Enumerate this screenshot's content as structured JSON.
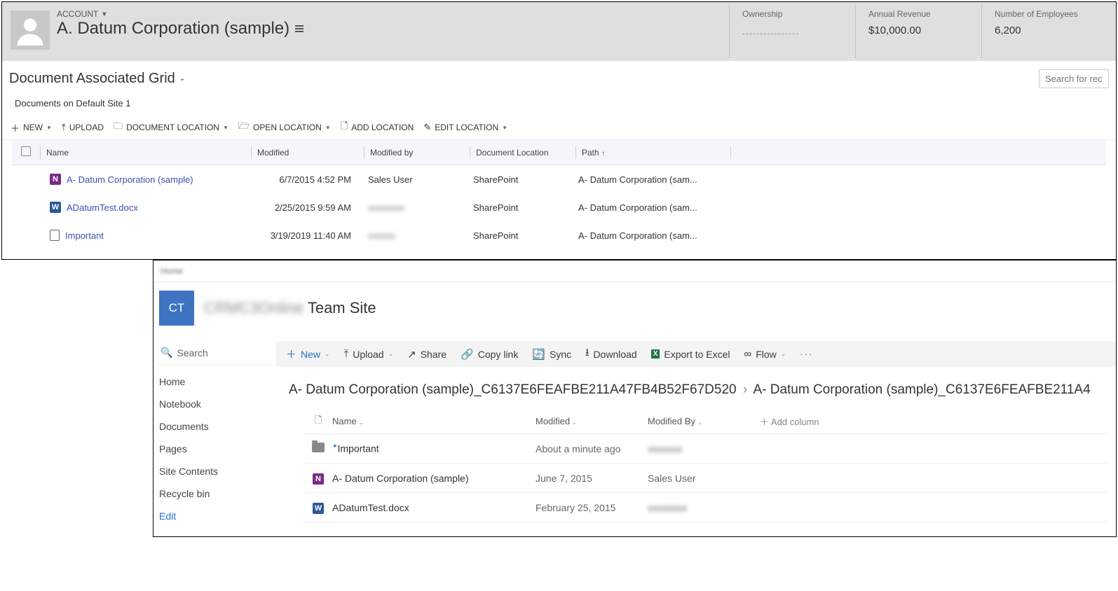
{
  "crm": {
    "account_label": "ACCOUNT",
    "record_name": "A. Datum Corporation (sample)",
    "stats": {
      "ownership": {
        "label": "Ownership",
        "value": ""
      },
      "revenue": {
        "label": "Annual Revenue",
        "value": "$10,000.00"
      },
      "employees": {
        "label": "Number of Employees",
        "value": "6,200"
      }
    },
    "subgrid_title": "Document Associated Grid",
    "search_placeholder": "Search for reco",
    "site_label": "Documents on Default Site 1",
    "commands": {
      "new": "NEW",
      "upload": "UPLOAD",
      "doc_location": "DOCUMENT LOCATION",
      "open_location": "OPEN LOCATION",
      "add_location": "ADD LOCATION",
      "edit_location": "EDIT LOCATION"
    },
    "columns": {
      "name": "Name",
      "modified": "Modified",
      "modified_by": "Modified by",
      "doc_location": "Document Location",
      "path": "Path"
    },
    "rows": [
      {
        "icon": "onenote",
        "name": "A- Datum Corporation (sample)",
        "modified": "6/7/2015 4:52 PM",
        "modified_by": "Sales User",
        "location": "SharePoint",
        "path": "A- Datum Corporation (sam..."
      },
      {
        "icon": "word",
        "name": "ADatumTest.docx",
        "modified": "2/25/2015 9:59 AM",
        "modified_by": "",
        "location": "SharePoint",
        "path": "A- Datum Corporation (sam..."
      },
      {
        "icon": "doc",
        "name": "Important",
        "modified": "3/19/2019 11:40 AM",
        "modified_by": "",
        "location": "SharePoint",
        "path": "A- Datum Corporation (sam..."
      }
    ]
  },
  "sp": {
    "topnav": "Home",
    "tile": "CT",
    "site_name_blur": "CRMC3Online",
    "site_name": "Team Site",
    "search_placeholder": "Search",
    "nav": [
      "Home",
      "Notebook",
      "Documents",
      "Pages",
      "Site Contents",
      "Recycle bin"
    ],
    "nav_edit": "Edit",
    "commands": {
      "new": "New",
      "upload": "Upload",
      "share": "Share",
      "copylink": "Copy link",
      "sync": "Sync",
      "download": "Download",
      "excel": "Export to Excel",
      "flow": "Flow"
    },
    "breadcrumb": {
      "part1": "A- Datum Corporation (sample)_C6137E6FEAFBE211A47FB4B52F67D520",
      "part2": "A- Datum Corporation (sample)_C6137E6FEAFBE211A4"
    },
    "columns": {
      "name": "Name",
      "modified": "Modified",
      "modified_by": "Modified By",
      "add": "Add column"
    },
    "rows": [
      {
        "icon": "folder",
        "name": "Important",
        "modified": "About a minute ago",
        "modified_by": ""
      },
      {
        "icon": "onenote",
        "name": "A- Datum Corporation (sample)",
        "modified": "June 7, 2015",
        "modified_by": "Sales User"
      },
      {
        "icon": "word",
        "name": "ADatumTest.docx",
        "modified": "February 25, 2015",
        "modified_by": ""
      }
    ]
  }
}
